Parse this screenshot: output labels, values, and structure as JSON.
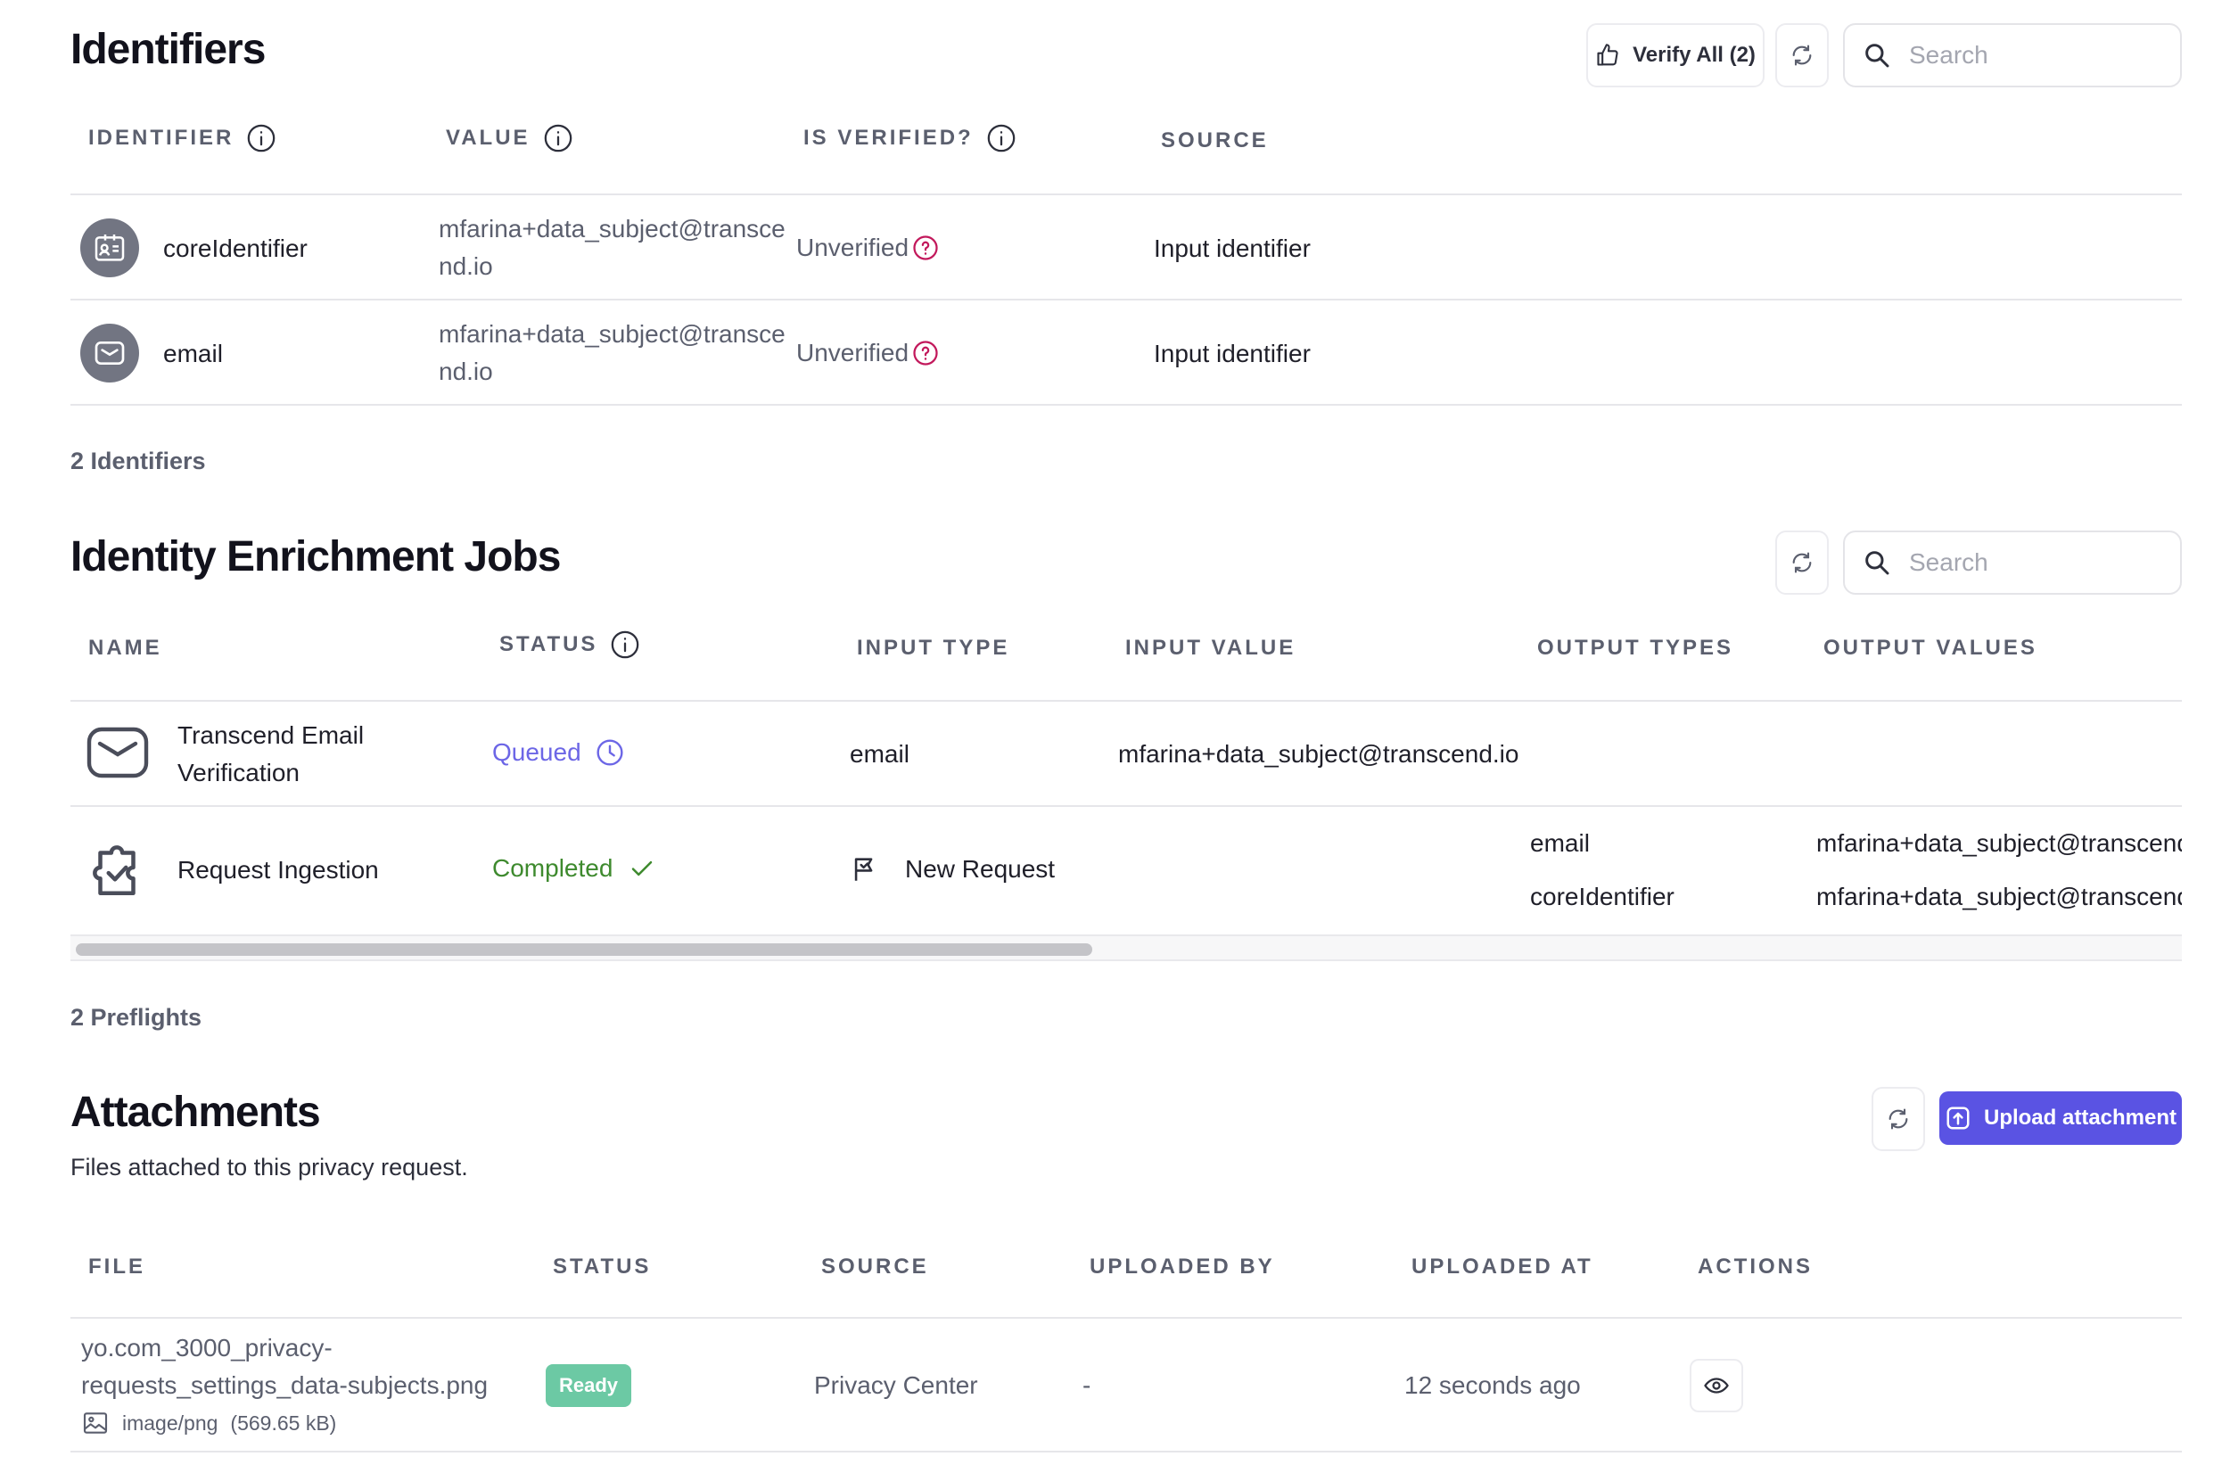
{
  "identifiers": {
    "title": "Identifiers",
    "verify_all_label": "Verify All (2)",
    "search_placeholder": "Search",
    "columns": [
      "IDENTIFIER",
      "VALUE",
      "IS VERIFIED?",
      "SOURCE"
    ],
    "rows": [
      {
        "name": "coreIdentifier",
        "value_line1": "mfarina+data_subject@transce",
        "value_line2": "nd.io",
        "verified": "Unverified",
        "source": "Input identifier",
        "icon": "id-card-icon"
      },
      {
        "name": "email",
        "value_line1": "mfarina+data_subject@transce",
        "value_line2": "nd.io",
        "verified": "Unverified",
        "source": "Input identifier",
        "icon": "mail-icon"
      }
    ],
    "count_label": "2 Identifiers"
  },
  "enrichment": {
    "title": "Identity Enrichment Jobs",
    "search_placeholder": "Search",
    "columns": [
      "NAME",
      "STATUS",
      "INPUT TYPE",
      "INPUT VALUE",
      "OUTPUT TYPES",
      "OUTPUT VALUES"
    ],
    "rows": [
      {
        "name_line1": "Transcend Email",
        "name_line2": "Verification",
        "status": "Queued",
        "status_color": "#6c66e6",
        "input_type": "email",
        "input_value": "mfarina+data_subject@transcend.io"
      },
      {
        "name": "Request Ingestion",
        "status": "Completed",
        "status_color": "#3e8a2e",
        "input_type": "New Request",
        "output_types": [
          "email",
          "coreIdentifier"
        ],
        "output_values": [
          "mfarina+data_subject@transcend.i",
          "mfarina+data_subject@transcend.i"
        ]
      }
    ],
    "count_label": "2 Preflights"
  },
  "attachments": {
    "title": "Attachments",
    "subtitle": "Files attached to this privacy request.",
    "upload_label": "Upload attachment",
    "columns": [
      "FILE",
      "STATUS",
      "SOURCE",
      "UPLOADED BY",
      "UPLOADED AT",
      "ACTIONS"
    ],
    "rows": [
      {
        "file_line1": "yo.com_3000_privacy-",
        "file_line2": "requests_settings_data-subjects.png",
        "mime": "image/png",
        "size": "(569.65 kB)",
        "status": "Ready",
        "source": "Privacy Center",
        "uploaded_by": "-",
        "uploaded_at": "12 seconds ago"
      }
    ]
  },
  "colors": {
    "accent": "#5a53e3",
    "ready": "#6cc9a4",
    "unverified_icon": "#c2185b"
  }
}
